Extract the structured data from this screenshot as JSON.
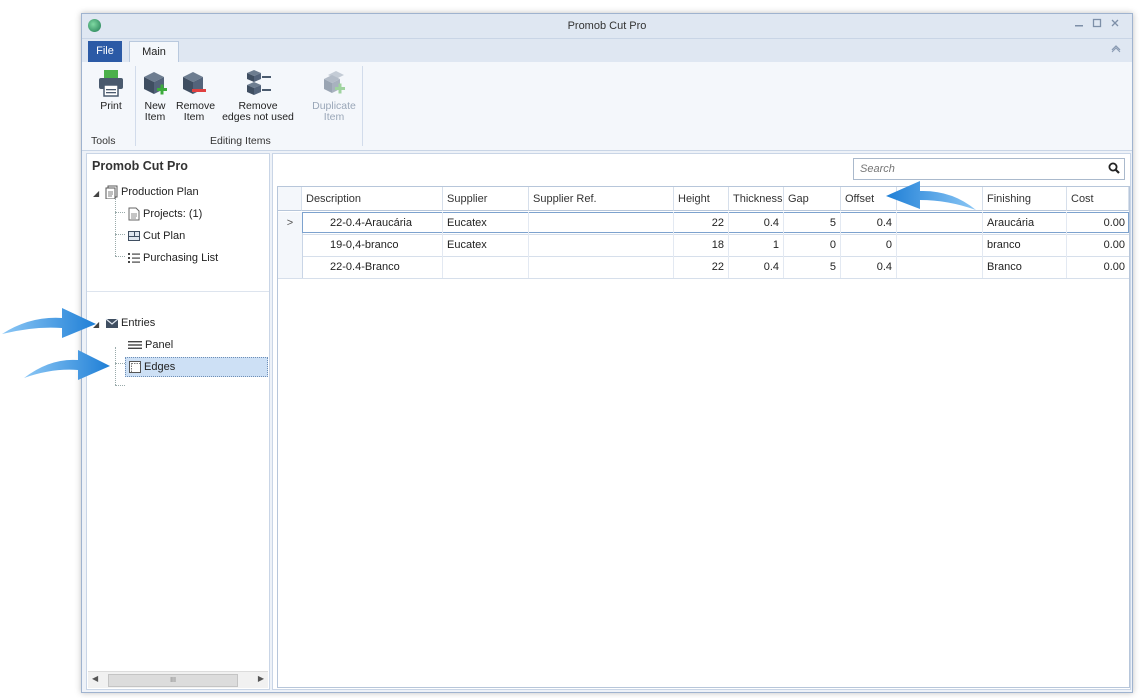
{
  "window": {
    "title": "Promob Cut Pro"
  },
  "ribbon": {
    "tabs": {
      "file": "File",
      "main": "Main"
    },
    "buttons": {
      "print": [
        "Print",
        ""
      ],
      "new_item": [
        "New",
        "Item"
      ],
      "remove_item": [
        "Remove",
        "Item"
      ],
      "remove_edges": [
        "Remove",
        "edges not used"
      ],
      "duplicate_item": [
        "Duplicate",
        "Item"
      ]
    },
    "groups": {
      "tools": "Tools",
      "editing": "Editing Items"
    }
  },
  "sidebar": {
    "title": "Promob Cut Pro",
    "tree": {
      "production_plan": "Production Plan",
      "projects": "Projects: (1)",
      "cut_plan": "Cut Plan",
      "purchasing_list": "Purchasing List",
      "entries": "Entries",
      "panel": "Panel",
      "edges": "Edges"
    },
    "scroll_thumb": "III"
  },
  "search": {
    "placeholder": "Search"
  },
  "table": {
    "columns": [
      "Description",
      "Supplier",
      "Supplier Ref.",
      "Height",
      "Thickness",
      "Gap",
      "Offset",
      "",
      "Finishing",
      "Cost"
    ],
    "row_indicator": ">",
    "rows": [
      [
        "22-0.4-Araucária",
        "Eucatex",
        "",
        "22",
        "0.4",
        "5",
        "0.4",
        "",
        "Araucária",
        "0.00"
      ],
      [
        "19-0,4-branco",
        "Eucatex",
        "",
        "18",
        "1",
        "0",
        "0",
        "",
        "branco",
        "0.00"
      ],
      [
        "22-0.4-Branco",
        "",
        "",
        "22",
        "0.4",
        "5",
        "0.4",
        "",
        "Branco",
        "0.00"
      ]
    ]
  },
  "colors": {
    "accent": "#2b5aa6",
    "arrow": "#2a8be0",
    "selection": "#cde0f5"
  }
}
